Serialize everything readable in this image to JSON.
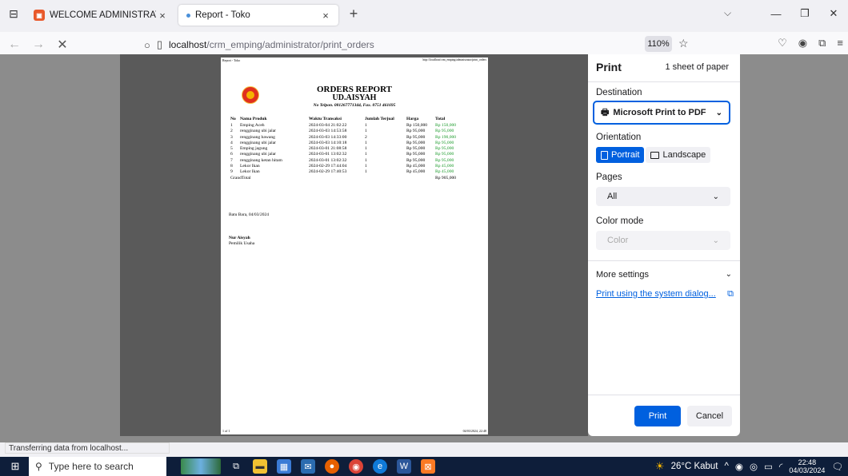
{
  "browser": {
    "tabs": [
      {
        "title": "WELCOME ADMINISTRATOR",
        "close": "×"
      },
      {
        "title": "Report - Toko",
        "close": "×"
      }
    ],
    "new_tab": "+",
    "url_host": "localhost",
    "url_path": "/crm_emping/administrator/print_orders",
    "zoom": "110%",
    "status_text": "Transferring data from localhost..."
  },
  "page": {
    "header_left": "Report - Toko",
    "header_right": "http://localhost/crm_emping/administrator/print_orders",
    "footer_left": "1 of 1",
    "footer_right": "04/03/2024, 22:48"
  },
  "report": {
    "title": "ORDERS REPORT",
    "company": "UD.AISYAH",
    "contact": "No Telpon. 081267771344, Fax. 0751 461695",
    "columns": [
      "No",
      "Nama Produk",
      "Waktu Transaksi",
      "Jumlah Terjual",
      "Harga",
      "Total"
    ],
    "rows": [
      [
        "1",
        "Emping Aceh",
        "2024-03-04 21:02:22",
        "1",
        "Rp 150,000",
        "Rp 150,000"
      ],
      [
        "2",
        "rengginang ubi jalar",
        "2024-03-03 14:53:58",
        "1",
        "Rp 95,000",
        "Rp 95,000"
      ],
      [
        "3",
        "rengginang bawang",
        "2024-03-03 14:33:00",
        "2",
        "Rp 95,000",
        "Rp 190,000"
      ],
      [
        "4",
        "rengginang ubi jalar",
        "2024-03-03 14:10:18",
        "1",
        "Rp 95,000",
        "Rp 95,000"
      ],
      [
        "5",
        "Emping jagung",
        "2024-03-01 21:08:58",
        "1",
        "Rp 95,000",
        "Rp 95,000"
      ],
      [
        "6",
        "rengginang ubi jalar",
        "2024-03-01 13:02:32",
        "1",
        "Rp 95,000",
        "Rp 95,000"
      ],
      [
        "7",
        "rengginang ketan hitam",
        "2024-03-01 13:02:32",
        "1",
        "Rp 95,000",
        "Rp 95,000"
      ],
      [
        "8",
        "Lekor Ikan",
        "2024-02-29 17:44:04",
        "1",
        "Rp 45,000",
        "Rp 45,000"
      ],
      [
        "9",
        "Lekor Ikan",
        "2024-02-29 17:40:53",
        "1",
        "Rp 45,000",
        "Rp 45,000"
      ]
    ],
    "grand_total_label": "GrandTotal",
    "grand_total": "Rp 905,000",
    "place_date": "Batu Bara, 04/03/2024",
    "signer_name": "Nur Aisyah",
    "signer_title": "Pemilik Usaha",
    "total_color": "#1a9a2a"
  },
  "print_panel": {
    "title": "Print",
    "sheets": "1 sheet of paper",
    "destination_label": "Destination",
    "destination_value": "Microsoft Print to PDF",
    "orientation_label": "Orientation",
    "portrait": "Portrait",
    "landscape": "Landscape",
    "pages_label": "Pages",
    "pages_value": "All",
    "color_mode_label": "Color mode",
    "color_mode_value": "Color",
    "more_settings": "More settings",
    "system_dialog": "Print using the system dialog...",
    "print_button": "Print",
    "cancel_button": "Cancel",
    "accent_color": "#0060df"
  },
  "taskbar": {
    "search_placeholder": "Type here to search",
    "weather": "26°C  Kabut",
    "time": "22:48",
    "date": "04/03/2024"
  }
}
